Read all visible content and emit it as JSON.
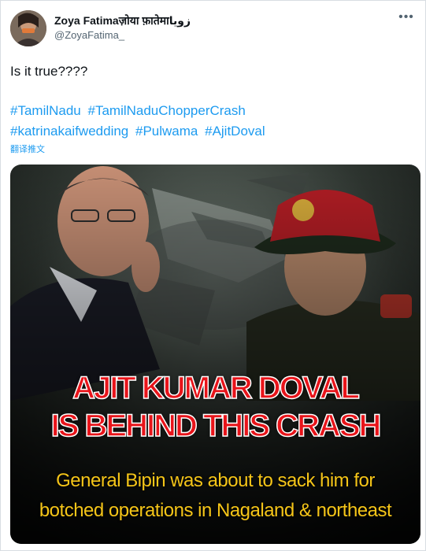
{
  "author": {
    "display_name": "Zoya Fatimaज़ोया फ़ातेमाزویا",
    "username": "@ZoyaFatima_"
  },
  "tweet": {
    "text": "Is it true????",
    "hashtags": [
      "#TamilNadu",
      "#TamilNaduChopperCrash",
      "#katrinakaifwedding",
      "#Pulwama",
      "#AjitDoval"
    ],
    "translate_label": "翻译推文"
  },
  "media": {
    "headline_line1": "AJIT KUMAR DOVAL",
    "headline_line2": "IS BEHIND THIS CRASH",
    "subtext_line1": "General Bipin was about to sack him for",
    "subtext_line2": "botched operations in Nagaland & northeast",
    "headline_color": "#e8141a",
    "subtext_color": "#f5c518"
  },
  "icons": {
    "more": "more-horizontal-icon"
  },
  "colors": {
    "link": "#1d9bf0",
    "text": "#0f1419",
    "muted": "#536471"
  }
}
